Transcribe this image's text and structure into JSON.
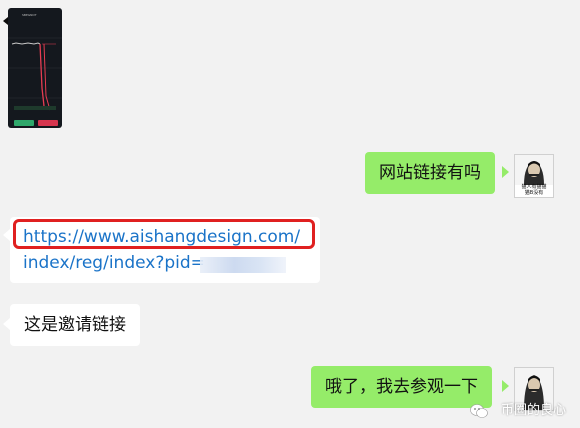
{
  "thumbnail": {
    "icon": "image-thumbnail",
    "title": "SBEGNOT"
  },
  "messages": [
    {
      "id": "m1",
      "side": "right",
      "text": "网站链接有吗"
    },
    {
      "id": "m2",
      "side": "left",
      "line1": "https://www.aishangdesign.com/",
      "line2": "index/reg/index?pid="
    },
    {
      "id": "m3",
      "side": "left",
      "text": "这是邀请链接"
    },
    {
      "id": "m4",
      "side": "right",
      "text": "哦了，我去参观一下"
    }
  ],
  "avatar": {
    "caption_line1": "猫人有猫猫",
    "caption_line2": "猫B没有"
  },
  "watermark": {
    "icon": "wechat-icon",
    "text": "币圈的良心"
  },
  "colors": {
    "chat_bg": "#f2f2f2",
    "bubble_green": "#95ec69",
    "bubble_white": "#ffffff",
    "link": "#1a73c8",
    "highlight": "#e02020"
  }
}
